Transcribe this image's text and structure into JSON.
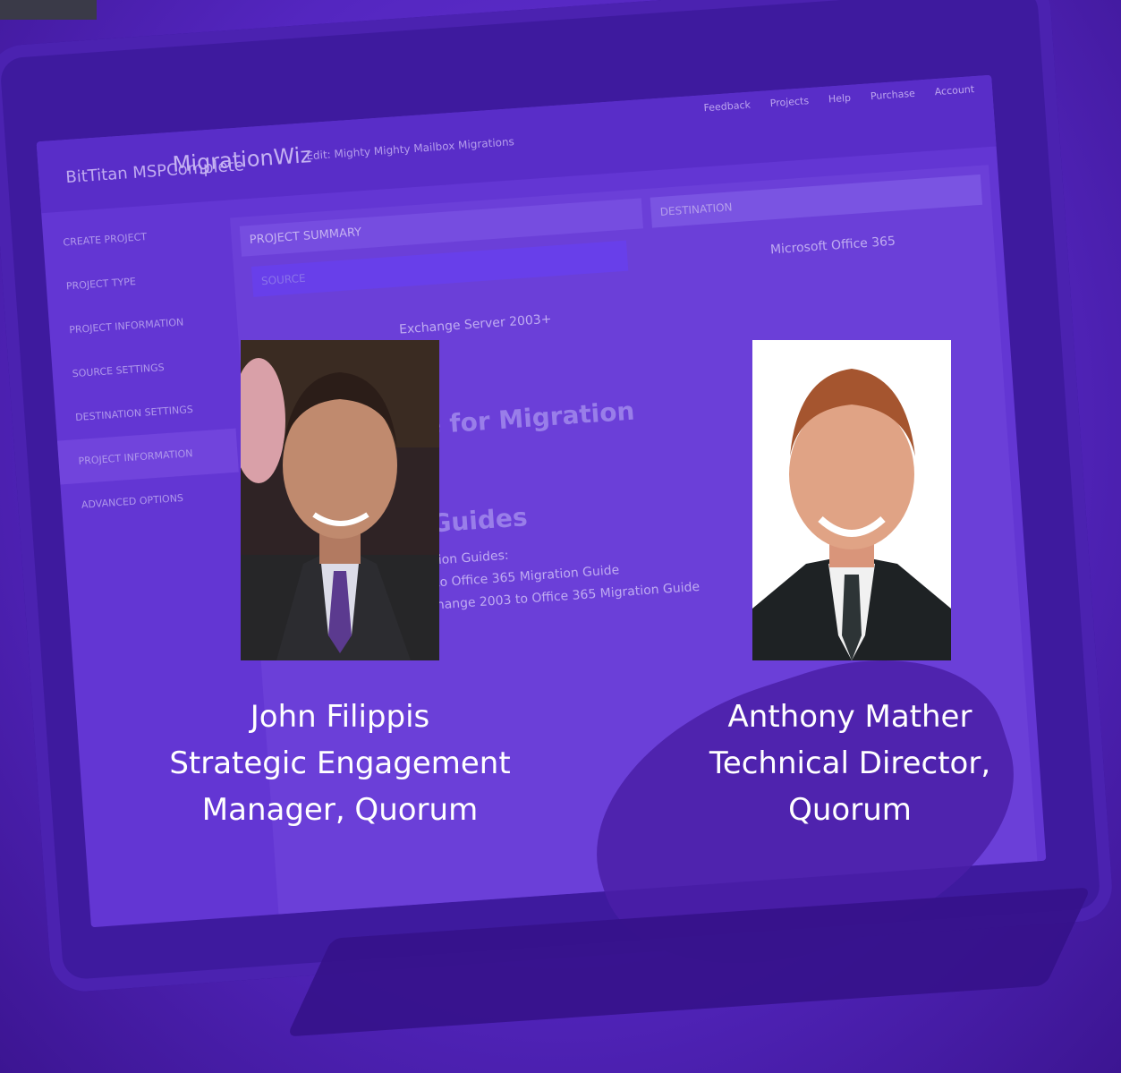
{
  "colors": {
    "overlay": "#5a2ac4",
    "caption": "#ffffff"
  },
  "screen_ui": {
    "brand_top": "BitTitan",
    "brand": "MSPComplete",
    "app": "MigrationWiz",
    "breadcrumb": "Edit: Mighty Mighty Mailbox Migrations",
    "menu": [
      "Feedback",
      "Projects",
      "Help",
      "Purchase",
      "Account"
    ],
    "sidebar": [
      "CREATE PROJECT",
      "PROJECT TYPE",
      "PROJECT INFORMATION",
      "SOURCE SETTINGS",
      "DESTINATION SETTINGS",
      "PROJECT INFORMATION",
      "ADVANCED OPTIONS"
    ],
    "summary_title": "PROJECT SUMMARY",
    "destination_title": "DESTINATION",
    "source_title": "SOURCE",
    "source_name": "Exchange Server 2003+",
    "destination_name": "Microsoft Office 365",
    "heading_migration": "e for Migration",
    "heading_guides": "Guides",
    "guide_intro": "tion Guides:",
    "guide1": "to Office 365 Migration Guide",
    "guide2": "hange 2003 to Office 365 Migration Guide"
  },
  "people": [
    {
      "name": "John Filippis",
      "title_line1": "Strategic Engagement",
      "title_line2": "Manager, Quorum"
    },
    {
      "name": "Anthony Mather",
      "title_line1": "Technical Director,",
      "title_line2": "Quorum"
    }
  ]
}
